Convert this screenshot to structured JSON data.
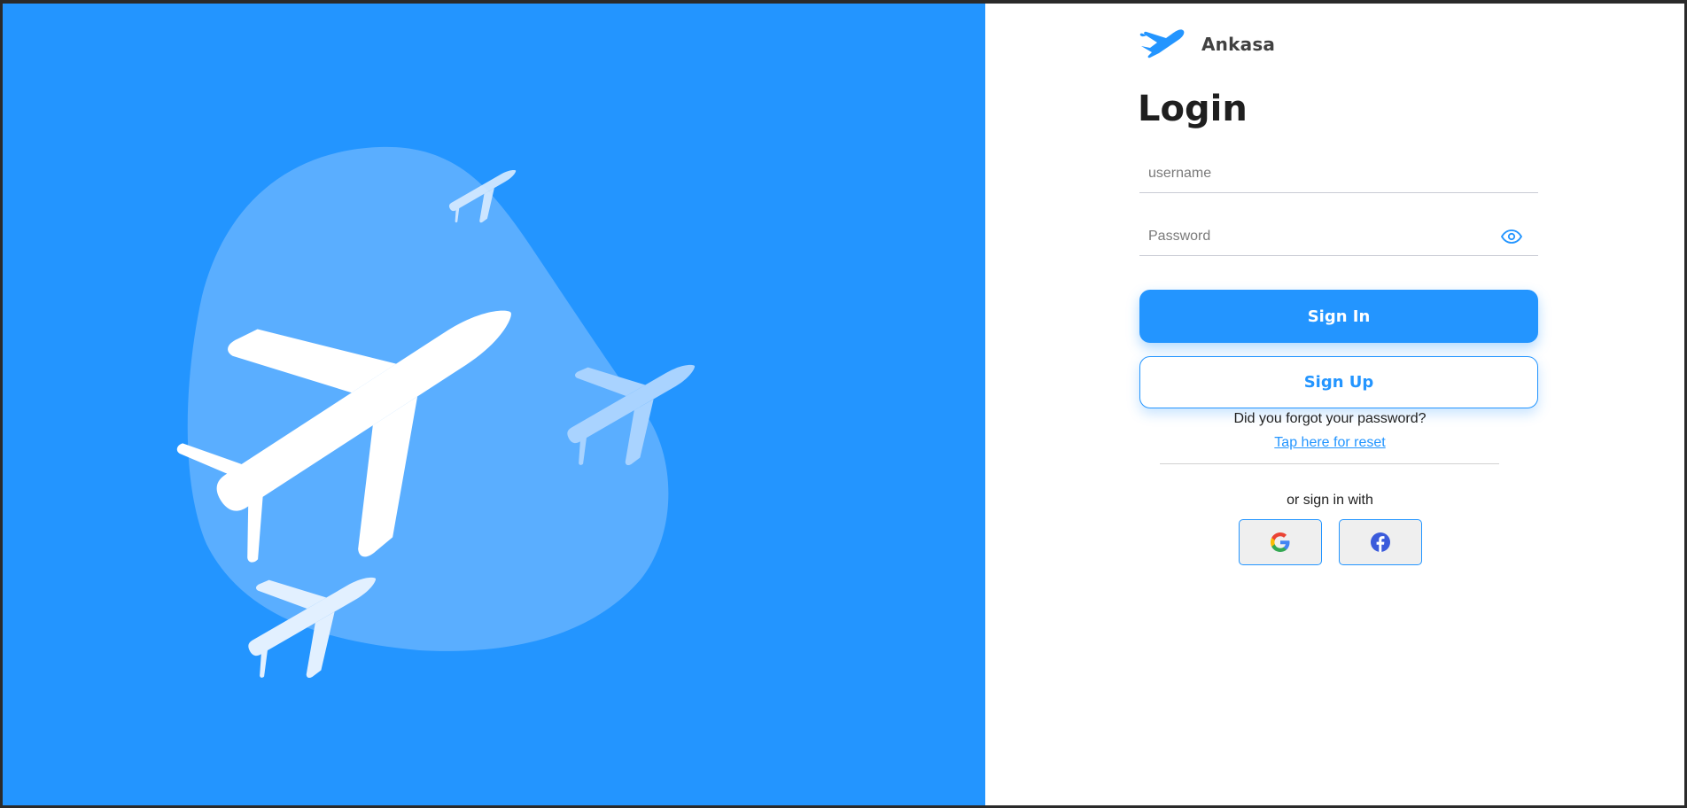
{
  "brand": {
    "name": "Ankasa",
    "icon": "airplane-logo-icon"
  },
  "login": {
    "title": "Login",
    "username_placeholder": "username",
    "password_placeholder": "Password",
    "signin_label": "Sign In",
    "signup_label": "Sign Up",
    "forgot_text": "Did you forgot your password?",
    "reset_link": "Tap here for reset",
    "or_text": "or sign in with"
  },
  "social": [
    {
      "name": "google",
      "icon": "google-icon"
    },
    {
      "name": "facebook",
      "icon": "facebook-icon"
    }
  ],
  "colors": {
    "accent": "#2395ff",
    "blob": "#5aaeff",
    "background": "#ffffff"
  }
}
